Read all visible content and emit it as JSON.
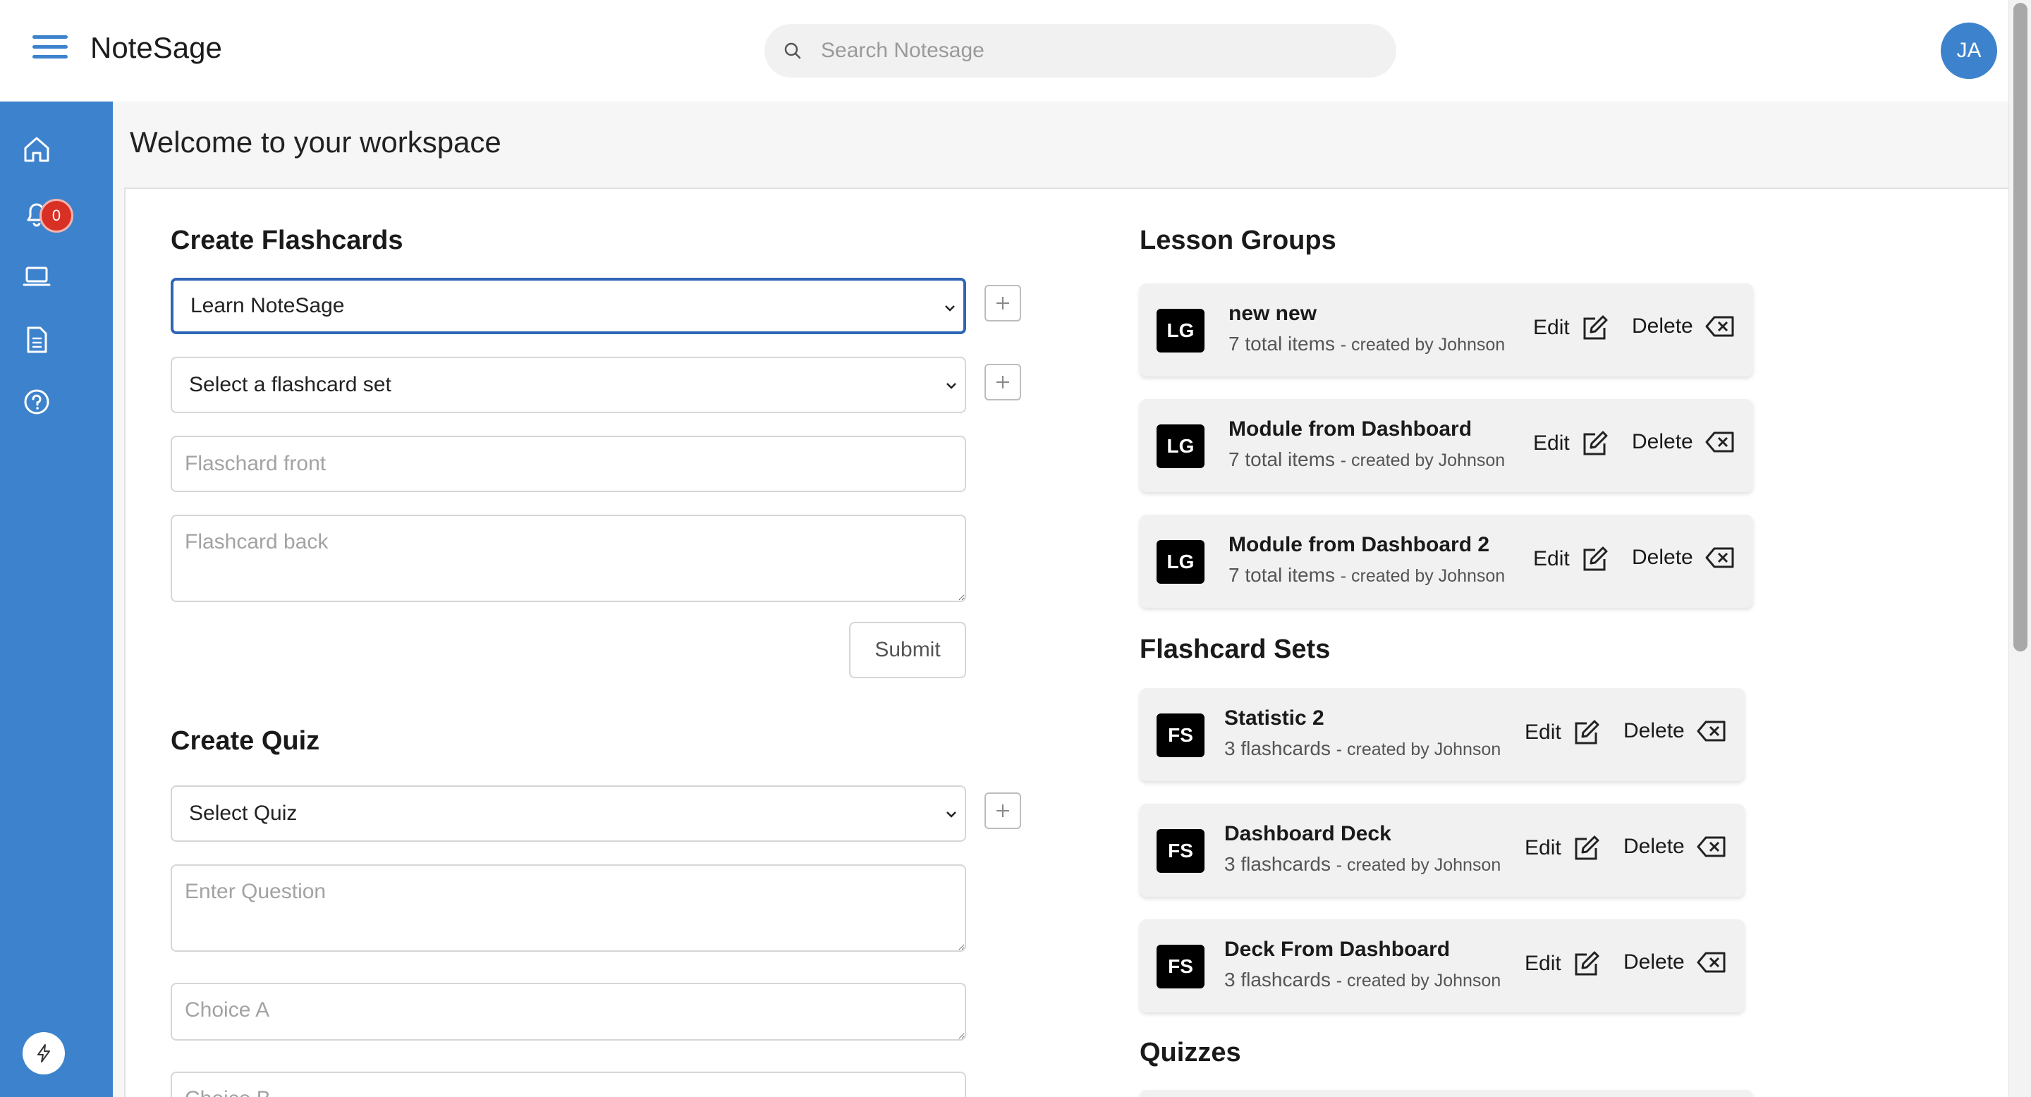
{
  "header": {
    "app_title": "NoteSage",
    "search_placeholder": "Search Notesage",
    "avatar_initials": "JA"
  },
  "sidebar": {
    "items": [
      {
        "icon": "home-icon"
      },
      {
        "icon": "bell-icon",
        "badge": "0"
      },
      {
        "icon": "laptop-icon"
      },
      {
        "icon": "document-icon"
      },
      {
        "icon": "help-circle-icon"
      }
    ],
    "bottom_icon": "lightning-icon"
  },
  "main": {
    "welcome": "Welcome to your workspace"
  },
  "flashcards_form": {
    "title": "Create Flashcards",
    "group_select": "Learn NoteSage",
    "set_select": "Select a flashcard set",
    "front_placeholder": "Flaschard front",
    "back_placeholder": "Flashcard back",
    "submit_label": "Submit"
  },
  "quiz_form": {
    "title": "Create Quiz",
    "quiz_select": "Select Quiz",
    "question_placeholder": "Enter Question",
    "choice_a_placeholder": "Choice A",
    "choice_b_placeholder": "Choice B"
  },
  "lesson_groups": {
    "title": "Lesson Groups",
    "items": [
      {
        "tag": "LG",
        "name": "new new",
        "count": "7 total items",
        "created": "- created by Johnson",
        "edit": "Edit",
        "delete": "Delete"
      },
      {
        "tag": "LG",
        "name": "Module from Dashboard",
        "count": "7 total items",
        "created": "- created by Johnson",
        "edit": "Edit",
        "delete": "Delete"
      },
      {
        "tag": "LG",
        "name": "Module from Dashboard 2",
        "count": "7 total items",
        "created": "- created by Johnson",
        "edit": "Edit",
        "delete": "Delete"
      }
    ]
  },
  "flashcard_sets": {
    "title": "Flashcard Sets",
    "items": [
      {
        "tag": "FS",
        "name": "Statistic 2",
        "count": "3 flashcards",
        "created": "- created by Johnson",
        "edit": "Edit",
        "delete": "Delete"
      },
      {
        "tag": "FS",
        "name": "Dashboard Deck",
        "count": "3 flashcards",
        "created": "- created by Johnson",
        "edit": "Edit",
        "delete": "Delete"
      },
      {
        "tag": "FS",
        "name": "Deck From Dashboard",
        "count": "3 flashcards",
        "created": "- created by Johnson",
        "edit": "Edit",
        "delete": "Delete"
      }
    ]
  },
  "quizzes": {
    "title": "Quizzes"
  },
  "colors": {
    "primary": "#3d82cc",
    "focus_border": "#2f65b4",
    "badge": "#d93025",
    "card_bg": "#f1f1f1"
  }
}
